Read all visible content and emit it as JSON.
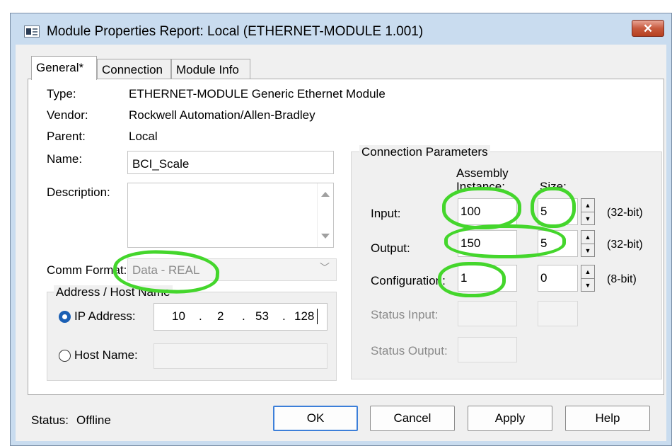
{
  "window": {
    "title": "Module Properties Report: Local (ETHERNET-MODULE 1.001)",
    "close_glyph": "✕"
  },
  "tabs": [
    {
      "label": "General*"
    },
    {
      "label": "Connection"
    },
    {
      "label": "Module Info"
    }
  ],
  "general": {
    "type_label": "Type:",
    "type_value": "ETHERNET-MODULE Generic Ethernet Module",
    "vendor_label": "Vendor:",
    "vendor_value": "Rockwell Automation/Allen-Bradley",
    "parent_label": "Parent:",
    "parent_value": "Local",
    "name_label": "Name:",
    "name_value": "BCI_Scale",
    "description_label": "Description:",
    "description_value": "",
    "comm_format_label": "Comm Format:",
    "comm_format_value": "Data - REAL"
  },
  "address": {
    "group_label": "Address / Host Name",
    "ip_label": "IP Address:",
    "ip_octets": [
      "10",
      "2",
      "53",
      "128"
    ],
    "ip_dot": ".",
    "host_label": "Host Name:",
    "host_value": "",
    "selected": "ip"
  },
  "connection_parameters": {
    "group_label": "Connection Parameters",
    "col_assembly": "Assembly",
    "col_instance": "Instance:",
    "col_size": "Size:",
    "rows": [
      {
        "label": "Input:",
        "instance": "100",
        "size": "5",
        "unit": "(32-bit)"
      },
      {
        "label": "Output:",
        "instance": "150",
        "size": "5",
        "unit": "(32-bit)"
      },
      {
        "label": "Configuration:",
        "instance": "1",
        "size": "0",
        "unit": "(8-bit)"
      }
    ],
    "status_input_label": "Status Input:",
    "status_output_label": "Status Output:"
  },
  "footer": {
    "status_label": "Status:",
    "status_value": "Offline",
    "ok": "OK",
    "cancel": "Cancel",
    "apply": "Apply",
    "help": "Help"
  },
  "colors": {
    "annotation": "#44d62c",
    "selection": "#1a5fb4",
    "close_button": "#c75a3e"
  }
}
